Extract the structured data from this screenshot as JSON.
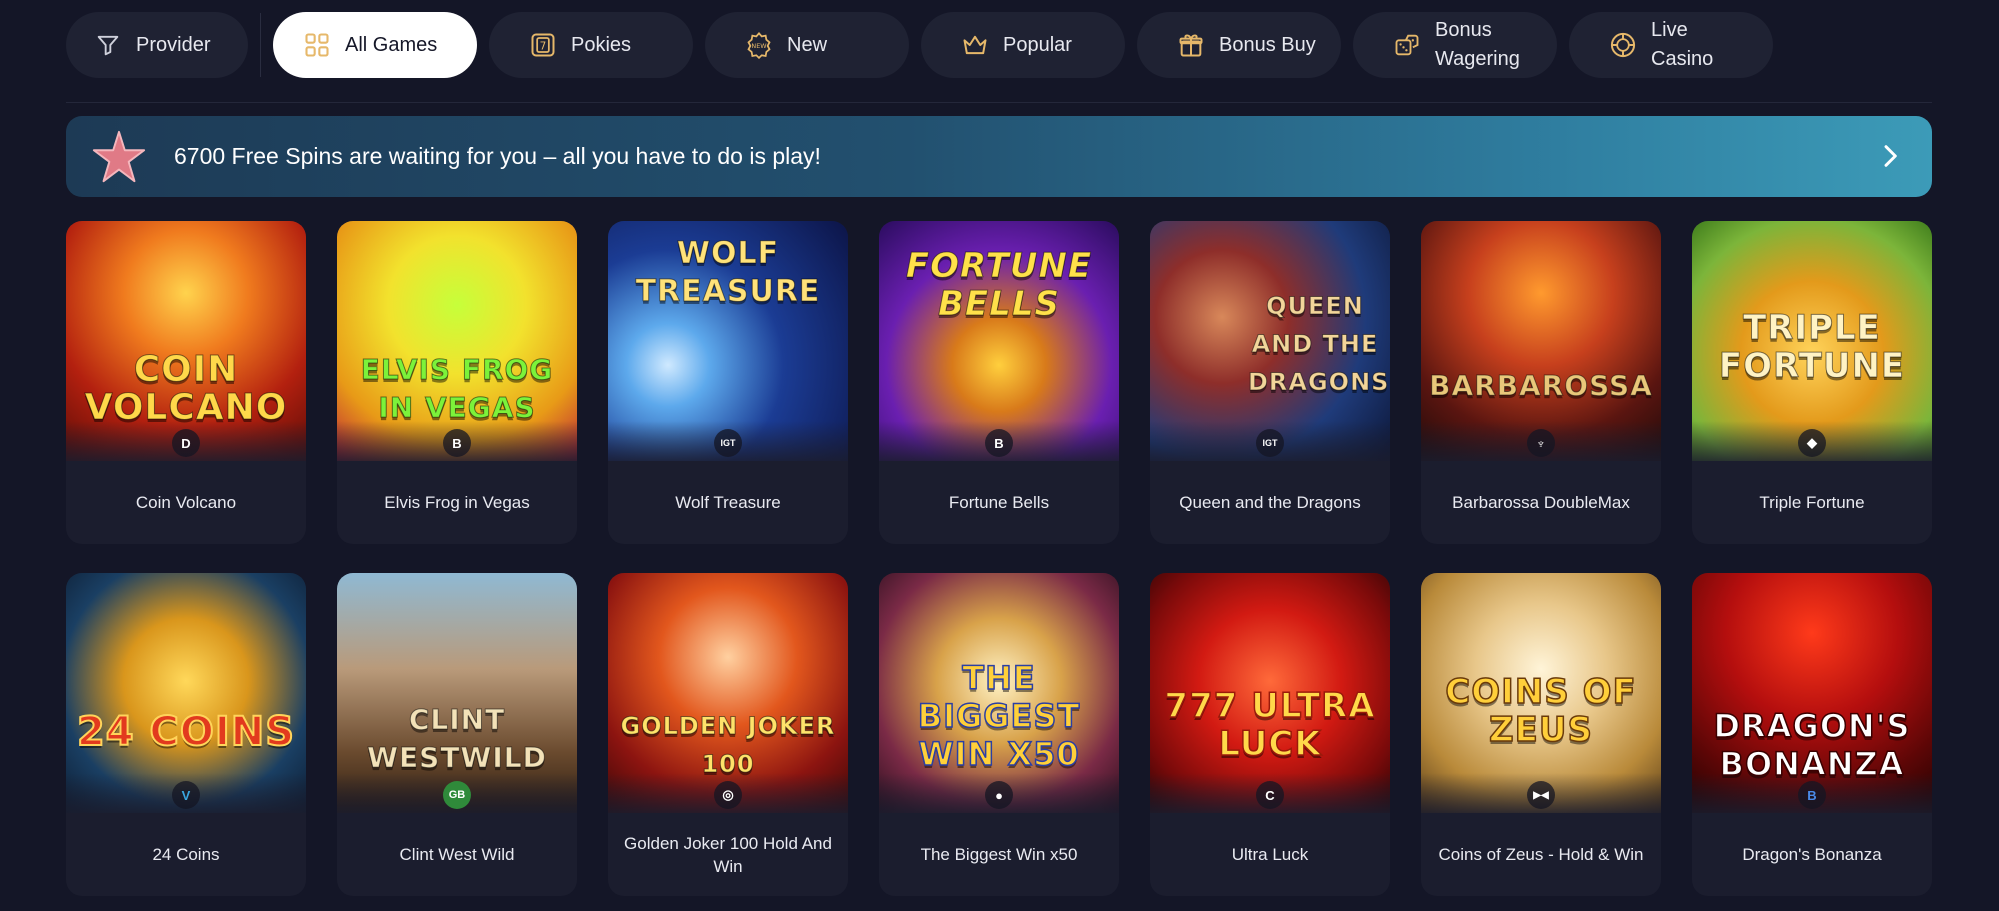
{
  "filters": {
    "provider": "Provider",
    "tabs": [
      {
        "label": "All Games",
        "icon": "grid-icon"
      },
      {
        "label": "Pokies",
        "icon": "pokies-icon"
      },
      {
        "label": "New",
        "icon": "new-badge-icon"
      },
      {
        "label": "Popular",
        "icon": "crown-icon"
      },
      {
        "label": "Bonus Buy",
        "icon": "gift-icon"
      },
      {
        "label": "Bonus Wagering",
        "icon": "dice-icon"
      },
      {
        "label": "Live Casino",
        "icon": "chip-icon"
      }
    ]
  },
  "banner": {
    "text": "6700 Free Spins are waiting for you – all you have to do is play!"
  },
  "games": [
    {
      "name": "Coin Volcano",
      "art": "Coin Volcano",
      "badge": "D"
    },
    {
      "name": "Elvis Frog in Vegas",
      "art": "Elvis Frog in Vegas",
      "badge": "B"
    },
    {
      "name": "Wolf Treasure",
      "art": "Wolf Treasure",
      "badge": "IGT"
    },
    {
      "name": "Fortune Bells",
      "art": "Fortune Bells",
      "badge": "B"
    },
    {
      "name": "Queen and the Dragons",
      "art": "Queen and the Dragons",
      "badge": "IGT"
    },
    {
      "name": "Barbarossa DoubleMax",
      "art": "Barbarossa",
      "badge": "♆"
    },
    {
      "name": "Triple Fortune",
      "art": "Triple Fortune",
      "badge": "◆"
    },
    {
      "name": "24 Coins",
      "art": "24 Coins",
      "badge": "V"
    },
    {
      "name": "Clint West Wild",
      "art": "Clint Westwild",
      "badge": "GB"
    },
    {
      "name": "Golden Joker 100 Hold And Win",
      "art": "Golden Joker 100",
      "badge": "◎"
    },
    {
      "name": "The Biggest Win x50",
      "art": "The Biggest Win x50",
      "badge": "●"
    },
    {
      "name": "Ultra Luck",
      "art": "777 Ultra Luck",
      "badge": "C"
    },
    {
      "name": "Coins of Zeus - Hold & Win",
      "art": "Coins of Zeus",
      "badge": "▶◀"
    },
    {
      "name": "Dragon's Bonanza",
      "art": "Dragon's Bonanza",
      "badge": "B"
    }
  ],
  "colors": {
    "background": "#141627",
    "pill": "#1f2233",
    "card": "#1b1d2e",
    "active_pill": "#ffffff",
    "icon_accent": "#e6b86a"
  }
}
